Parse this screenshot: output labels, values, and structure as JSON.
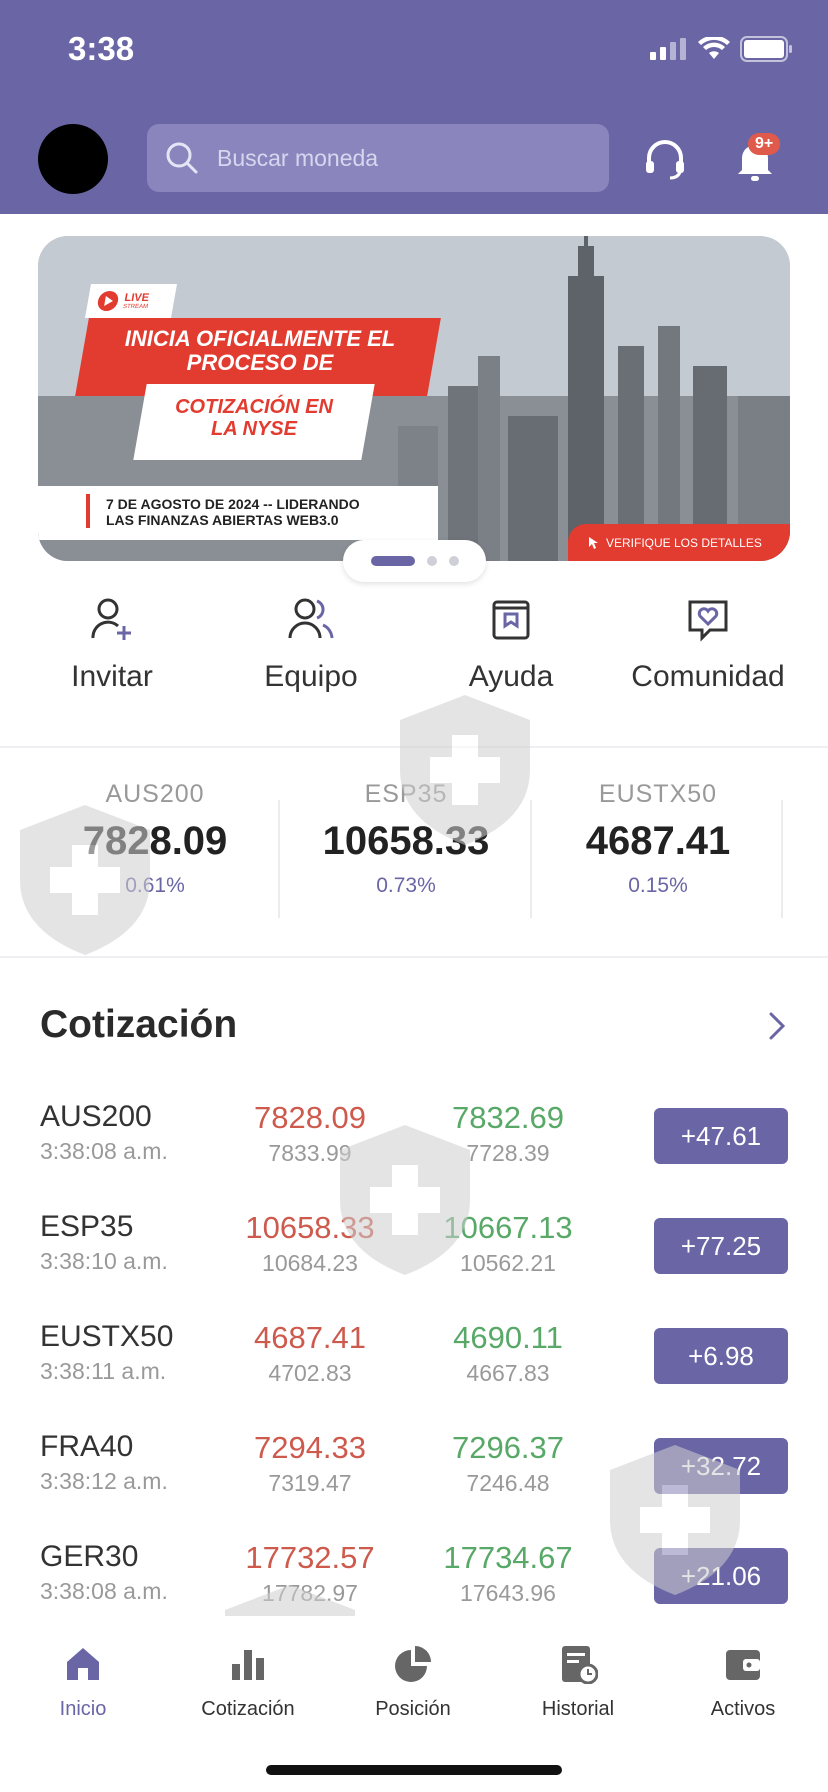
{
  "status_bar": {
    "time": "3:38"
  },
  "header": {
    "search_placeholder": "Buscar moneda",
    "notification_badge": "9+"
  },
  "banner": {
    "live_label": "LIVE",
    "live_sub": "STREAM",
    "headline_line1": "INICIA OFICIALMENTE EL",
    "headline_line2": "PROCESO DE",
    "highlight_line1": "COTIZACIÓN EN",
    "highlight_line2": "LA NYSE",
    "date_line1": "7 DE AGOSTO DE 2024 -- LIDERANDO",
    "date_line2": "LAS FINANZAS ABIERTAS WEB3.0",
    "cta": "VERIFIQUE LOS DETALLES"
  },
  "shortcuts": [
    {
      "label": "Invitar",
      "icon": "user-plus-icon"
    },
    {
      "label": "Equipo",
      "icon": "team-icon"
    },
    {
      "label": "Ayuda",
      "icon": "book-icon"
    },
    {
      "label": "Comunidad",
      "icon": "chat-heart-icon"
    }
  ],
  "indices": [
    {
      "name": "AUS200",
      "value": "7828.09",
      "pct": "0.61%"
    },
    {
      "name": "ESP35",
      "value": "10658.33",
      "pct": "0.73%"
    },
    {
      "name": "EUSTX50",
      "value": "4687.41",
      "pct": "0.15%"
    }
  ],
  "quotes": {
    "title": "Cotización",
    "rows": [
      {
        "name": "AUS200",
        "time": "3:38:08 a.m.",
        "bid": "7828.09",
        "bid_sub": "7833.99",
        "ask": "7832.69",
        "ask_sub": "7728.39",
        "change": "+47.61"
      },
      {
        "name": "ESP35",
        "time": "3:38:10 a.m.",
        "bid": "10658.33",
        "bid_sub": "10684.23",
        "ask": "10667.13",
        "ask_sub": "10562.21",
        "change": "+77.25"
      },
      {
        "name": "EUSTX50",
        "time": "3:38:11 a.m.",
        "bid": "4687.41",
        "bid_sub": "4702.83",
        "ask": "4690.11",
        "ask_sub": "4667.83",
        "change": "+6.98"
      },
      {
        "name": "FRA40",
        "time": "3:38:12 a.m.",
        "bid": "7294.33",
        "bid_sub": "7319.47",
        "ask": "7296.37",
        "ask_sub": "7246.48",
        "change": "+32.72"
      },
      {
        "name": "GER30",
        "time": "3:38:08 a.m.",
        "bid": "17732.57",
        "bid_sub": "17782.97",
        "ask": "17734.67",
        "ask_sub": "17643.96",
        "change": "+21.06"
      }
    ]
  },
  "tabbar": [
    {
      "label": "Inicio",
      "icon": "home-icon",
      "active": true
    },
    {
      "label": "Cotización",
      "icon": "bar-chart-icon",
      "active": false
    },
    {
      "label": "Posición",
      "icon": "pie-chart-icon",
      "active": false
    },
    {
      "label": "Historial",
      "icon": "history-icon",
      "active": false
    },
    {
      "label": "Activos",
      "icon": "wallet-icon",
      "active": false
    }
  ],
  "colors": {
    "brand": "#6a66a6",
    "bid": "#cd5a4d",
    "ask": "#58a867"
  }
}
